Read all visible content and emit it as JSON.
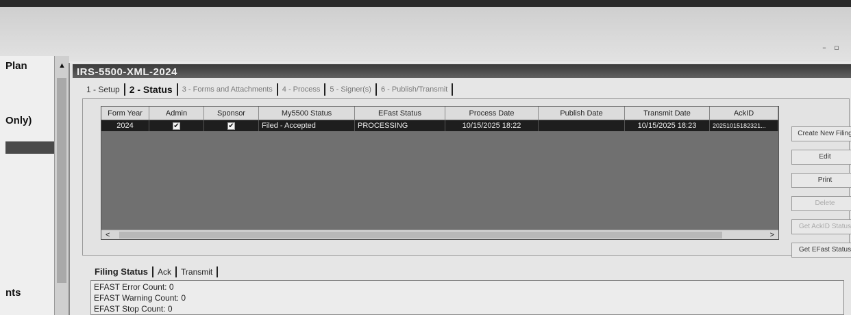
{
  "left_panel": {
    "item_1": "Plan",
    "item_2": "Only)",
    "item_3": "nts"
  },
  "form": {
    "title": "IRS-5500-XML-2024"
  },
  "tabs": [
    {
      "label": "1 - Setup"
    },
    {
      "label": "2 - Status"
    },
    {
      "label": "3 - Forms and Attachments"
    },
    {
      "label": "4 - Process"
    },
    {
      "label": "5 - Signer(s)"
    },
    {
      "label": "6 - Publish/Transmit"
    }
  ],
  "grid": {
    "headers": [
      "Form Year",
      "Admin",
      "Sponsor",
      "My5500 Status",
      "EFast Status",
      "Process Date",
      "Publish Date",
      "Transmit Date",
      "AckID"
    ],
    "rows": [
      {
        "form_year": "2024",
        "admin_checked": true,
        "sponsor_checked": true,
        "my5500_status": "Filed - Accepted",
        "efast_status": "PROCESSING",
        "process_date": "10/15/2025 18:22",
        "publish_date": "",
        "transmit_date": "10/15/2025 18:23",
        "ack_id": "20251015182321..."
      }
    ]
  },
  "buttons": [
    {
      "label": "Create New Filing",
      "enabled": true
    },
    {
      "label": "Edit",
      "enabled": true
    },
    {
      "label": "Print",
      "enabled": true
    },
    {
      "label": "Delete",
      "enabled": false
    },
    {
      "label": "Get AckID Status",
      "enabled": false
    },
    {
      "label": "Get EFast Status",
      "enabled": true
    }
  ],
  "bottom_tabs": [
    {
      "label": "Filing Status"
    },
    {
      "label": "Ack"
    },
    {
      "label": "Transmit"
    }
  ],
  "status_lines": [
    "EFAST Error Count: 0",
    "EFAST Warning Count: 0",
    "EFAST Stop Count: 0"
  ]
}
